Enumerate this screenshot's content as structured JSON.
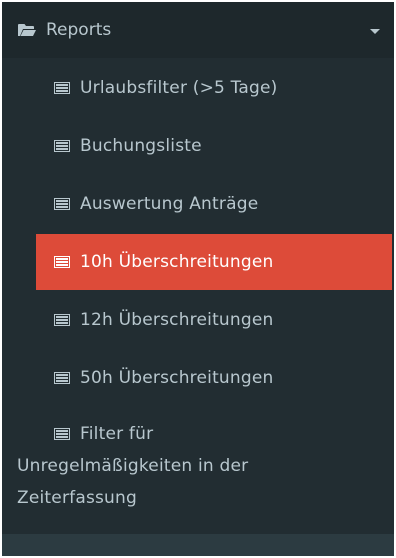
{
  "section": {
    "title": "Reports",
    "icon": "folder-open-icon",
    "chevron": "caret-down-icon"
  },
  "items": [
    {
      "label": "Urlaubsfilter (>5 Tage)",
      "icon": "list-alt-icon",
      "active": false
    },
    {
      "label": "Buchungsliste",
      "icon": "list-alt-icon",
      "active": false
    },
    {
      "label": "Auswertung Anträge",
      "icon": "list-alt-icon",
      "active": false
    },
    {
      "label": "10h Überschreitungen",
      "icon": "list-alt-icon",
      "active": true
    },
    {
      "label": "12h Überschreitungen",
      "icon": "list-alt-icon",
      "active": false
    },
    {
      "label": "50h Überschreitungen",
      "icon": "list-alt-icon",
      "active": false
    }
  ],
  "multiline_item": {
    "line1": "Filter für",
    "line2": "Unregelmäßigkeiten in der",
    "line3": "Zeiterfassung",
    "icon": "list-alt-icon"
  },
  "colors": {
    "sidebar_bg": "#222d32",
    "header_bg": "#1e282c",
    "text": "#b8c7ce",
    "active_bg": "#dd4b39",
    "active_text": "#ffffff"
  }
}
